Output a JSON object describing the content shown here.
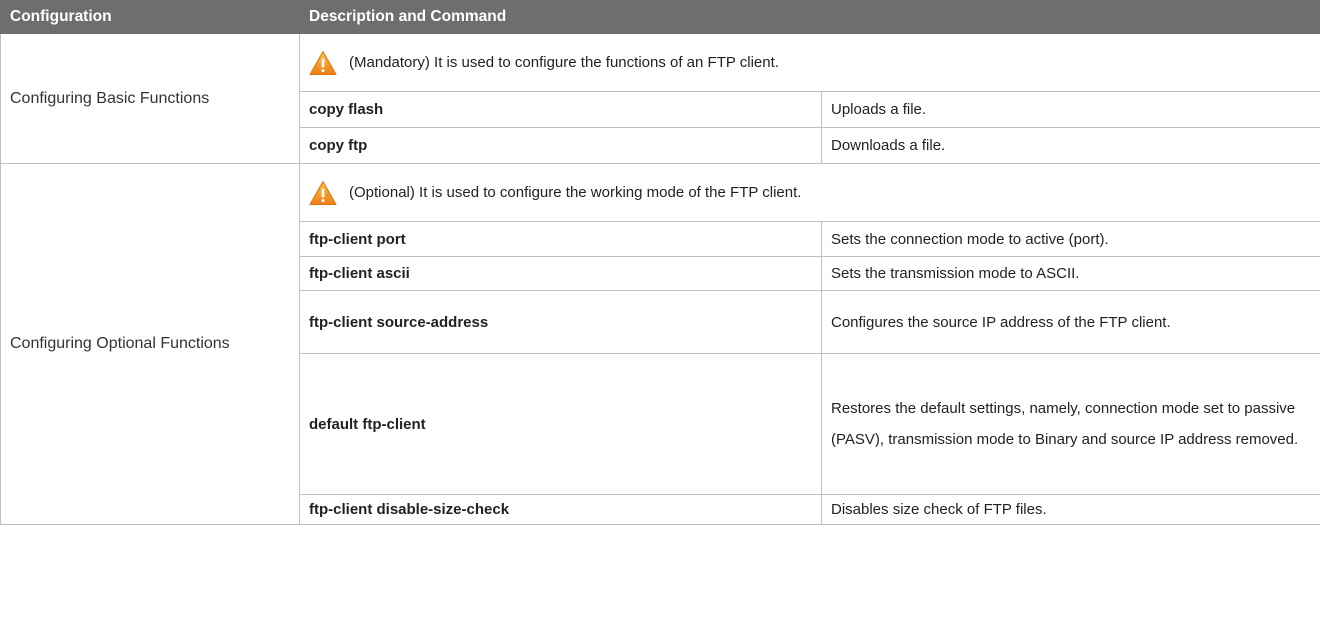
{
  "table": {
    "headers": {
      "configuration": "Configuration",
      "description": "Description and Command"
    },
    "groups": [
      {
        "configuration": "Configuring Basic Functions",
        "note_icon": "warning-icon",
        "note": "(Mandatory) It is used to configure the functions of an FTP client.",
        "rows": [
          {
            "command": "copy flash",
            "description": "Uploads a file."
          },
          {
            "command": "copy ftp",
            "description": "Downloads a file."
          }
        ]
      },
      {
        "configuration": "Configuring Optional Functions",
        "note_icon": "warning-icon",
        "note": "(Optional) It is used to configure the working mode of the FTP client.",
        "rows": [
          {
            "command": "ftp-client port",
            "description": "Sets the connection mode to active (port)."
          },
          {
            "command": "ftp-client ascii",
            "description": "Sets the transmission mode to ASCII."
          },
          {
            "command": "ftp-client source-address",
            "description": "Configures the source IP address of the FTP client."
          },
          {
            "command": "default ftp-client",
            "description": "Restores the default settings, namely, connection mode set to passive (PASV), transmission mode to Binary and source IP address removed."
          },
          {
            "command": "ftp-client disable-size-check",
            "description": "Disables size check of FTP files."
          }
        ]
      }
    ]
  },
  "colors": {
    "header_bg": "#6e6e6e",
    "header_text": "#ffffff",
    "border": "#bfbfbf",
    "warning_orange": "#f39a1e"
  }
}
